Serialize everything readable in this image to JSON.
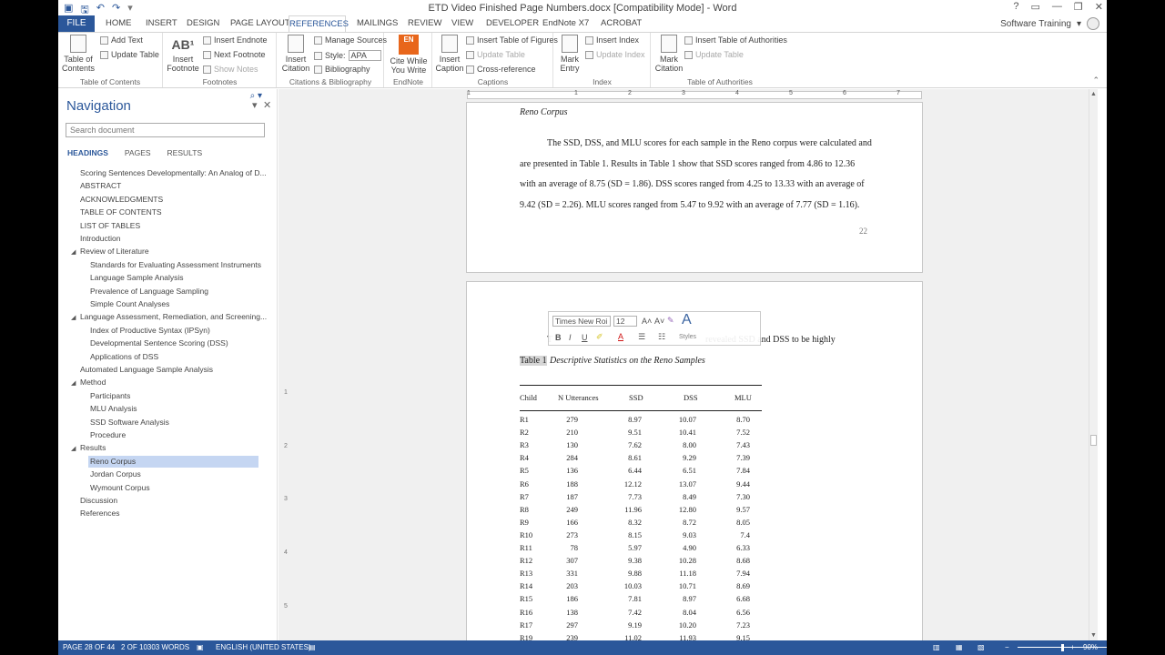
{
  "window": {
    "title": "ETD Video Finished Page Numbers.docx [Compatibility Mode] - Word",
    "user": "Software Training",
    "controls": [
      "?",
      "▭",
      "—",
      "❐",
      "✕"
    ]
  },
  "qat": [
    "save-icon",
    "undo-icon",
    "redo-icon"
  ],
  "tabs": {
    "file": "FILE",
    "items": [
      "HOME",
      "INSERT",
      "DESIGN",
      "PAGE LAYOUT",
      "REFERENCES",
      "MAILINGS",
      "REVIEW",
      "VIEW",
      "DEVELOPER",
      "EndNote X7",
      "ACROBAT"
    ],
    "active": "REFERENCES"
  },
  "ribbon": {
    "toc": {
      "big": "Table of\nContents",
      "add_text": "Add Text",
      "update_table": "Update Table",
      "label": "Table of Contents"
    },
    "footnotes": {
      "big": "Insert\nFootnote",
      "insert_endnote": "Insert Endnote",
      "next_footnote": "Next Footnote",
      "show_notes": "Show Notes",
      "label": "Footnotes"
    },
    "citations": {
      "big": "Insert\nCitation",
      "manage_sources": "Manage Sources",
      "style_label": "Style:",
      "style_value": "APA",
      "bibliography": "Bibliography",
      "label": "Citations & Bibliography"
    },
    "endnote": {
      "big": "Cite While\nYou Write",
      "label": "EndNote"
    },
    "captions": {
      "big": "Insert\nCaption",
      "insert_tof": "Insert Table of Figures",
      "update_table": "Update Table",
      "cross_reference": "Cross-reference",
      "label": "Captions"
    },
    "index": {
      "big": "Mark\nEntry",
      "insert_index": "Insert Index",
      "update_index": "Update Index",
      "label": "Index"
    },
    "authorities": {
      "big": "Mark\nCitation",
      "insert_toa": "Insert Table of Authorities",
      "update_table": "Update Table",
      "label": "Table of Authorities"
    }
  },
  "navigation": {
    "title": "Navigation",
    "search_placeholder": "Search document",
    "tabs": [
      "HEADINGS",
      "PAGES",
      "RESULTS"
    ],
    "active_tab": "HEADINGS",
    "headings": [
      {
        "text": "Scoring Sentences Developmentally: An Analog of D...",
        "level": 1,
        "caret": false,
        "selected": false
      },
      {
        "text": "ABSTRACT",
        "level": 1,
        "caret": false,
        "selected": false
      },
      {
        "text": "ACKNOWLEDGMENTS",
        "level": 1,
        "caret": false,
        "selected": false
      },
      {
        "text": "TABLE OF CONTENTS",
        "level": 1,
        "caret": false,
        "selected": false
      },
      {
        "text": "LIST OF TABLES",
        "level": 1,
        "caret": false,
        "selected": false
      },
      {
        "text": "Introduction",
        "level": 1,
        "caret": false,
        "selected": false
      },
      {
        "text": "Review of Literature",
        "level": 1,
        "caret": true,
        "selected": false
      },
      {
        "text": "Standards for Evaluating Assessment Instruments",
        "level": 2,
        "caret": false,
        "selected": false
      },
      {
        "text": "Language Sample Analysis",
        "level": 2,
        "caret": false,
        "selected": false
      },
      {
        "text": "Prevalence of Language Sampling",
        "level": 2,
        "caret": false,
        "selected": false
      },
      {
        "text": "Simple Count Analyses",
        "level": 2,
        "caret": false,
        "selected": false
      },
      {
        "text": "Language Assessment, Remediation, and Screening...",
        "level": 1,
        "caret": true,
        "selected": false
      },
      {
        "text": "Index of Productive Syntax (IPSyn)",
        "level": 2,
        "caret": false,
        "selected": false
      },
      {
        "text": "Developmental Sentence Scoring (DSS)",
        "level": 2,
        "caret": false,
        "selected": false
      },
      {
        "text": "Applications of DSS",
        "level": 2,
        "caret": false,
        "selected": false
      },
      {
        "text": "Automated Language Sample Analysis",
        "level": 1,
        "caret": false,
        "selected": false
      },
      {
        "text": "Method",
        "level": 1,
        "caret": true,
        "selected": false
      },
      {
        "text": "Participants",
        "level": 2,
        "caret": false,
        "selected": false
      },
      {
        "text": "MLU Analysis",
        "level": 2,
        "caret": false,
        "selected": false
      },
      {
        "text": "SSD Software Analysis",
        "level": 2,
        "caret": false,
        "selected": false
      },
      {
        "text": "Procedure",
        "level": 2,
        "caret": false,
        "selected": false
      },
      {
        "text": "Results",
        "level": 1,
        "caret": true,
        "selected": false
      },
      {
        "text": "Reno Corpus",
        "level": 2,
        "caret": false,
        "selected": true
      },
      {
        "text": "Jordan Corpus",
        "level": 2,
        "caret": false,
        "selected": false
      },
      {
        "text": "Wymount Corpus",
        "level": 2,
        "caret": false,
        "selected": false
      },
      {
        "text": "Discussion",
        "level": 1,
        "caret": false,
        "selected": false
      },
      {
        "text": "References",
        "level": 1,
        "caret": false,
        "selected": false
      }
    ]
  },
  "ruler": {
    "ticks": [
      "1",
      "1",
      "2",
      "3",
      "4",
      "5",
      "6",
      "7"
    ]
  },
  "vruler": {
    "ticks": [
      "1",
      "2",
      "3",
      "4",
      "5"
    ]
  },
  "page1": {
    "heading": "Reno Corpus",
    "lines": [
      "The SSD, DSS, and MLU scores for each sample in the Reno corpus were calculated and",
      "are presented in Table 1. Results in Table 1 show that SSD scores ranged from 4.86 to 12.36",
      "with an average of 8.75 (SD = 1.86). DSS scores ranged from 4.25 to 13.33 with an average of",
      "9.42 (SD = 2.26). MLU scores ranged from 5.47 to 9.92 with an average of 7.77 (SD = 1.16)."
    ],
    "page_number": "22"
  },
  "page2": {
    "partial_line_start": "T",
    "partial_line_end": "revealed SSD and DSS to be highly",
    "caption_label": "Table 1",
    "caption_title": "Descriptive Statistics on the Reno Samples",
    "table": {
      "headers": [
        "Child",
        "N Utterances",
        "SSD",
        "DSS",
        "MLU"
      ],
      "rows": [
        [
          "R1",
          "279",
          "8.97",
          "10.07",
          "8.70"
        ],
        [
          "R2",
          "210",
          "9.51",
          "10.41",
          "7.52"
        ],
        [
          "R3",
          "130",
          "7.62",
          "8.00",
          "7.43"
        ],
        [
          "R4",
          "284",
          "8.61",
          "9.29",
          "7.39"
        ],
        [
          "R5",
          "136",
          "6.44",
          "6.51",
          "7.84"
        ],
        [
          "R6",
          "188",
          "12.12",
          "13.07",
          "9.44"
        ],
        [
          "R7",
          "187",
          "7.73",
          "8.49",
          "7.30"
        ],
        [
          "R8",
          "249",
          "11.96",
          "12.80",
          "9.57"
        ],
        [
          "R9",
          "166",
          "8.32",
          "8.72",
          "8.05"
        ],
        [
          "R10",
          "273",
          "8.15",
          "9.03",
          "7.4"
        ],
        [
          "R11",
          "78",
          "5.97",
          "4.90",
          "6.33"
        ],
        [
          "R12",
          "307",
          "9.38",
          "10.28",
          "8.68"
        ],
        [
          "R13",
          "331",
          "9.88",
          "11.18",
          "7.94"
        ],
        [
          "R14",
          "203",
          "10.03",
          "10.71",
          "8.69"
        ],
        [
          "R15",
          "186",
          "7.81",
          "8.97",
          "6.68"
        ],
        [
          "R16",
          "138",
          "7.42",
          "8.04",
          "6.56"
        ],
        [
          "R17",
          "297",
          "9.19",
          "10.20",
          "7.23"
        ],
        [
          "R19",
          "239",
          "11.02",
          "11.93",
          "9.15"
        ]
      ]
    }
  },
  "minitoolbar": {
    "font": "Times New Roi",
    "size": "12",
    "grow": "A˄",
    "shrink": "A˅",
    "bold": "B",
    "italic": "I",
    "underline": "U",
    "styles": "Styles"
  },
  "status": {
    "page": "PAGE 28 OF 44",
    "words": "2 OF 10303 WORDS",
    "language": "ENGLISH (UNITED STATES)",
    "zoom": "90%",
    "zoom_level": 90
  },
  "colors": {
    "accent": "#2b579a",
    "endnote": "#e8661b",
    "selection": "#c5d6f2"
  }
}
